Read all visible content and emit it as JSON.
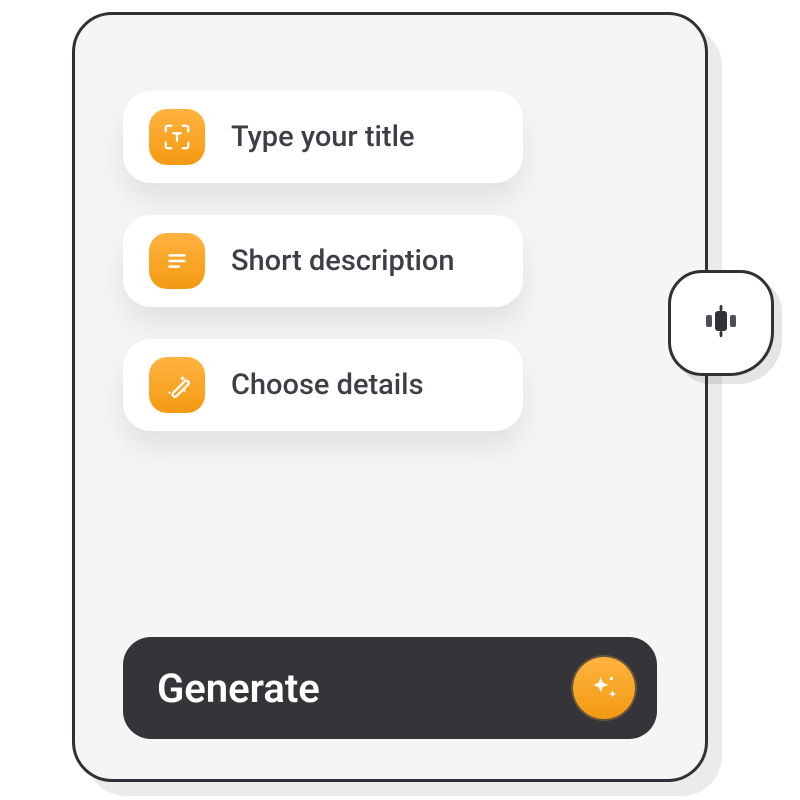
{
  "inputs": {
    "title": {
      "label": "Type your title",
      "icon": "text-frame-icon"
    },
    "description": {
      "label": "Short description",
      "icon": "lines-icon"
    },
    "details": {
      "label": "Choose details",
      "icon": "wand-icon"
    }
  },
  "generate": {
    "label": "Generate",
    "icon": "sparkle-icon"
  },
  "float_button": {
    "icon": "carousel-icon"
  },
  "colors": {
    "accent": "#f7a21b",
    "dark": "#343439",
    "card": "#f5f5f5"
  }
}
